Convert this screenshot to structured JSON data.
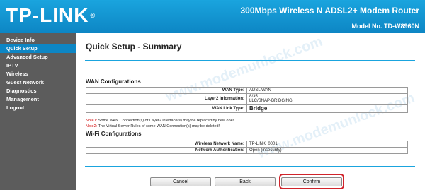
{
  "header": {
    "logo_text": "TP-LINK",
    "logo_reg": "®",
    "product_title": "300Mbps Wireless N ADSL2+ Modem Router",
    "model": "Model No. TD-W8960N"
  },
  "sidebar": {
    "items": [
      {
        "label": "Device Info",
        "active": false
      },
      {
        "label": "Quick Setup",
        "active": true
      },
      {
        "label": "Advanced Setup",
        "active": false
      },
      {
        "label": "IPTV",
        "active": false
      },
      {
        "label": "Wireless",
        "active": false
      },
      {
        "label": "Guest Network",
        "active": false
      },
      {
        "label": "Diagnostics",
        "active": false
      },
      {
        "label": "Management",
        "active": false
      },
      {
        "label": "Logout",
        "active": false
      }
    ]
  },
  "main": {
    "page_title": "Quick Setup - Summary",
    "wan_section_title": "WAN Configurations",
    "wan_rows": [
      {
        "label": "WAN Type:",
        "value": "ADSL WAN"
      },
      {
        "label": "Layer2 Information:",
        "value_line1": "8/35",
        "value_line2": "LLC/SNAP-BRIDGING"
      },
      {
        "label": "WAN Link Type:",
        "value": "Bridge"
      }
    ],
    "note1_key": "Note1:",
    "note1_text": " Some WAN Connection(s) or Layer2 interface(s) may be replaced by new one!",
    "note2_key": "Note2:",
    "note2_text": " The Virtual Server Rules of some WAN Connection(s) may be deleted!",
    "wifi_section_title": "Wi-Fi Configurations",
    "wifi_rows": [
      {
        "label": "Wireless Network Name:",
        "value": "TP-LINK_0001"
      },
      {
        "label": "Network Authentication:",
        "value": "Open (insecurity)"
      }
    ],
    "buttons": {
      "cancel": "Cancel",
      "back": "Back",
      "confirm": "Confirm"
    },
    "watermark_text": "www.modemunlock.com"
  },
  "colors": {
    "header_blue": "#1aa4de",
    "sidebar_gray": "#5c5c5c",
    "active_blue": "#0d86c4",
    "note_red": "#d00000",
    "highlight_red": "#d0242b"
  }
}
